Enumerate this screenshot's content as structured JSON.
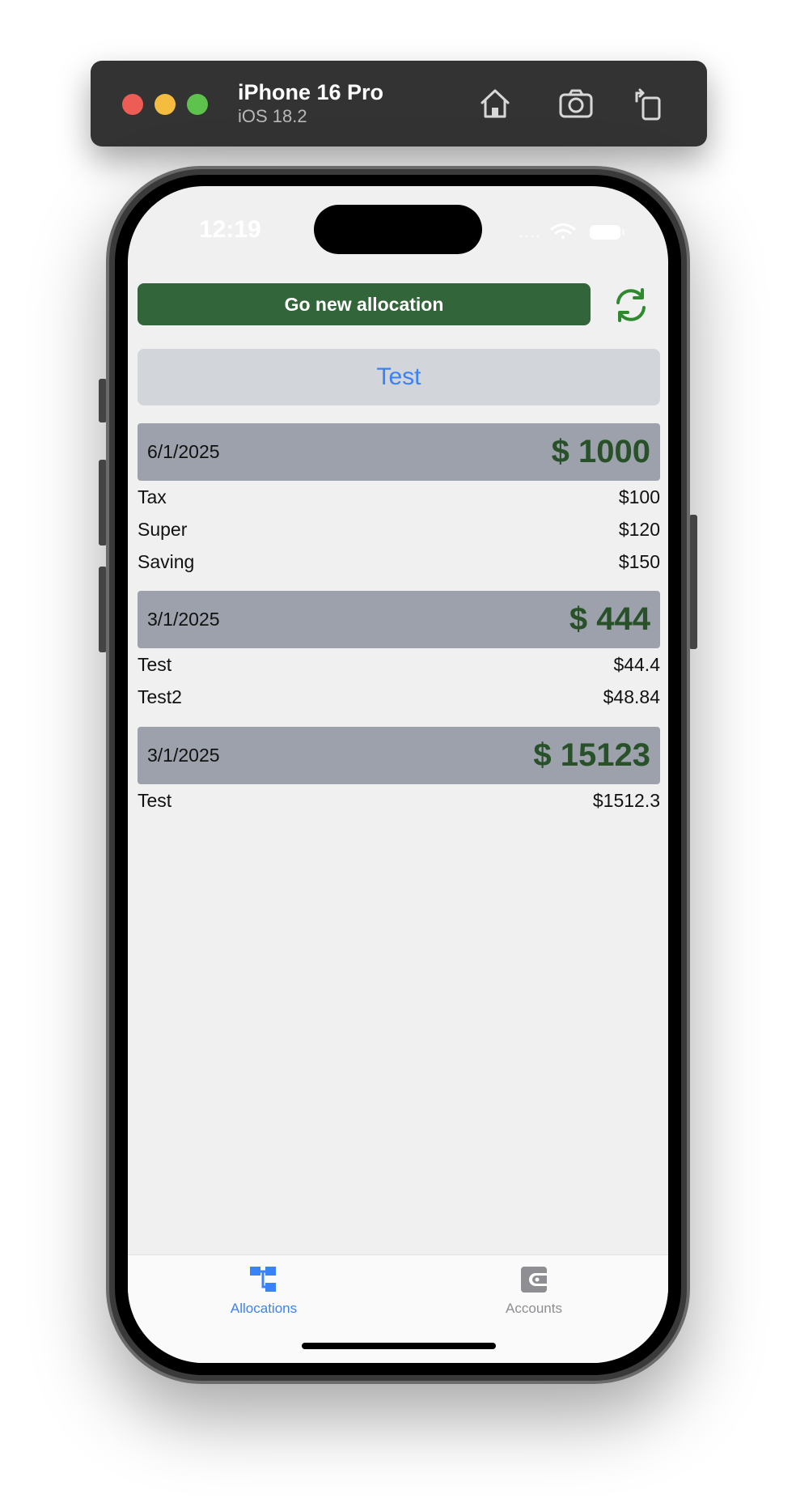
{
  "simulator": {
    "device_name": "iPhone 16 Pro",
    "os_version": "iOS 18.2",
    "icons": [
      "home-icon",
      "screenshot-icon",
      "rotate-icon"
    ]
  },
  "status_bar": {
    "time": "12:19"
  },
  "header": {
    "new_allocation_label": "Go new allocation",
    "refresh_icon": "refresh-icon"
  },
  "group": {
    "title": "Test"
  },
  "allocations": [
    {
      "date": "6/1/2025",
      "total": "$ 1000",
      "items": [
        {
          "name": "Tax",
          "amount": "$100"
        },
        {
          "name": "Super",
          "amount": "$120"
        },
        {
          "name": "Saving",
          "amount": "$150"
        }
      ]
    },
    {
      "date": "3/1/2025",
      "total": "$ 444",
      "items": [
        {
          "name": "Test",
          "amount": "$44.4"
        },
        {
          "name": "Test2",
          "amount": "$48.84"
        }
      ]
    },
    {
      "date": "3/1/2025",
      "total": "$ 15123",
      "items": [
        {
          "name": "Test",
          "amount": "$1512.3"
        }
      ]
    }
  ],
  "tabbar": {
    "tabs": [
      {
        "label": "Allocations",
        "icon": "allocations-icon",
        "active": true
      },
      {
        "label": "Accounts",
        "icon": "wallet-icon",
        "active": false
      }
    ]
  },
  "colors": {
    "primary_green": "#33653a",
    "total_green": "#285129",
    "accent_blue": "#3a82f7",
    "header_gray": "#9ca1ab"
  }
}
